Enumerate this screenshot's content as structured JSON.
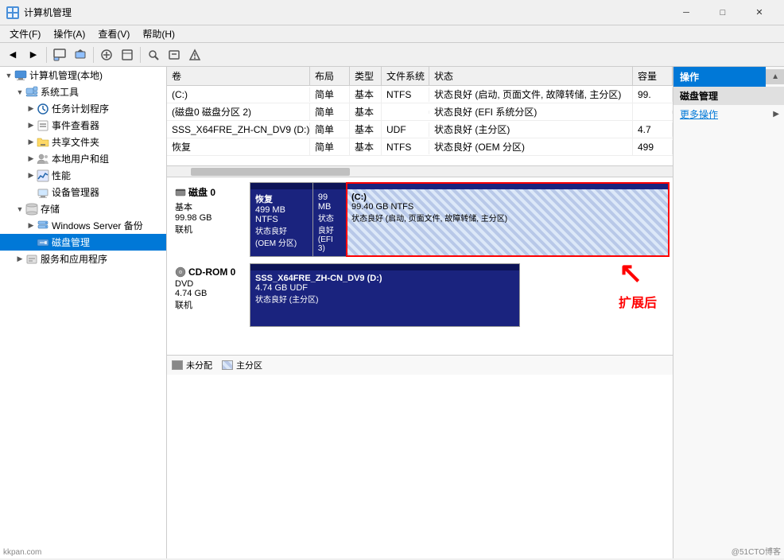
{
  "window": {
    "title": "计算机管理",
    "min_btn": "─",
    "max_btn": "□",
    "close_btn": "✕"
  },
  "menu": {
    "items": [
      "文件(F)",
      "操作(A)",
      "查看(V)",
      "帮助(H)"
    ]
  },
  "tree": {
    "root_label": "计算机管理(本地)",
    "items": [
      {
        "id": "computer",
        "label": "计算机管理(本地)",
        "level": 0,
        "expanded": true,
        "has_arrow": true
      },
      {
        "id": "system-tools",
        "label": "系统工具",
        "level": 1,
        "expanded": true,
        "has_arrow": true
      },
      {
        "id": "task-scheduler",
        "label": "任务计划程序",
        "level": 2,
        "expanded": false,
        "has_arrow": true
      },
      {
        "id": "event-viewer",
        "label": "事件查看器",
        "level": 2,
        "expanded": false,
        "has_arrow": true
      },
      {
        "id": "shared-folders",
        "label": "共享文件夹",
        "level": 2,
        "expanded": false,
        "has_arrow": true
      },
      {
        "id": "local-users",
        "label": "本地用户和组",
        "level": 2,
        "expanded": false,
        "has_arrow": true
      },
      {
        "id": "performance",
        "label": "性能",
        "level": 2,
        "expanded": false,
        "has_arrow": true
      },
      {
        "id": "device-mgr",
        "label": "设备管理器",
        "level": 2,
        "expanded": false,
        "has_arrow": false
      },
      {
        "id": "storage",
        "label": "存储",
        "level": 1,
        "expanded": true,
        "has_arrow": true
      },
      {
        "id": "windows-server",
        "label": "Windows Server 备份",
        "level": 2,
        "expanded": false,
        "has_arrow": true
      },
      {
        "id": "disk-mgmt",
        "label": "磁盘管理",
        "level": 2,
        "expanded": false,
        "has_arrow": false,
        "selected": true
      },
      {
        "id": "services",
        "label": "服务和应用程序",
        "level": 1,
        "expanded": false,
        "has_arrow": true
      }
    ]
  },
  "table": {
    "columns": [
      "卷",
      "布局",
      "类型",
      "文件系统",
      "状态",
      "容量"
    ],
    "rows": [
      {
        "vol": "(C:)",
        "layout": "简单",
        "type": "基本",
        "fs": "NTFS",
        "status": "状态良好 (启动, 页面文件, 故障转储, 主分区)",
        "cap": "99."
      },
      {
        "vol": "(磁盘0 磁盘分区 2)",
        "layout": "简单",
        "type": "基本",
        "fs": "",
        "status": "状态良好 (EFI 系统分区)",
        "cap": ""
      },
      {
        "vol": "SSS_X64FRE_ZH-CN_DV9 (D:)",
        "layout": "简单",
        "type": "基本",
        "fs": "UDF",
        "status": "状态良好 (主分区)",
        "cap": "4.7"
      },
      {
        "vol": "恢复",
        "layout": "简单",
        "type": "基本",
        "fs": "NTFS",
        "status": "状态良好 (OEM 分区)",
        "cap": "499"
      }
    ]
  },
  "disks": [
    {
      "id": "disk0",
      "name": "磁盘 0",
      "type": "基本",
      "size": "99.98 GB",
      "status": "联机",
      "partitions": [
        {
          "label": "恢复",
          "size": "499 MB NTFS",
          "status": "状态良好 (OEM 分区)",
          "width_pct": 15,
          "style": "dark-blue"
        },
        {
          "label": "",
          "size": "99 MB",
          "status": "状态良好 (EFI 3)",
          "width_pct": 8,
          "style": "dark-blue"
        },
        {
          "label": "(C:)",
          "size": "99.40 GB NTFS",
          "status": "状态良好 (启动, 页面文件, 故障转储, 主分区)",
          "width_pct": 77,
          "style": "ntfs",
          "selected": true
        }
      ]
    },
    {
      "id": "cdrom0",
      "name": "CD-ROM 0",
      "type": "DVD",
      "size": "4.74 GB",
      "status": "联机",
      "partitions": [
        {
          "label": "SSS_X64FRE_ZH-CN_DV9 (D:)",
          "size": "4.74 GB UDF",
          "status": "状态良好 (主分区)",
          "width_pct": 100,
          "style": "dark-blue"
        }
      ]
    }
  ],
  "legend": {
    "items": [
      {
        "label": "未分配",
        "style": "unalloc"
      },
      {
        "label": "主分区",
        "style": "primary"
      }
    ]
  },
  "actions": {
    "header": "操作",
    "section1": "磁盘管理",
    "section1_arrow": "▲",
    "link1": "更多操作",
    "link1_arrow": "▶"
  },
  "annotation": {
    "text": "扩展后",
    "arrow": "↗"
  },
  "watermarks": {
    "left": "kkpan.com",
    "right": "@51CTO博客"
  }
}
